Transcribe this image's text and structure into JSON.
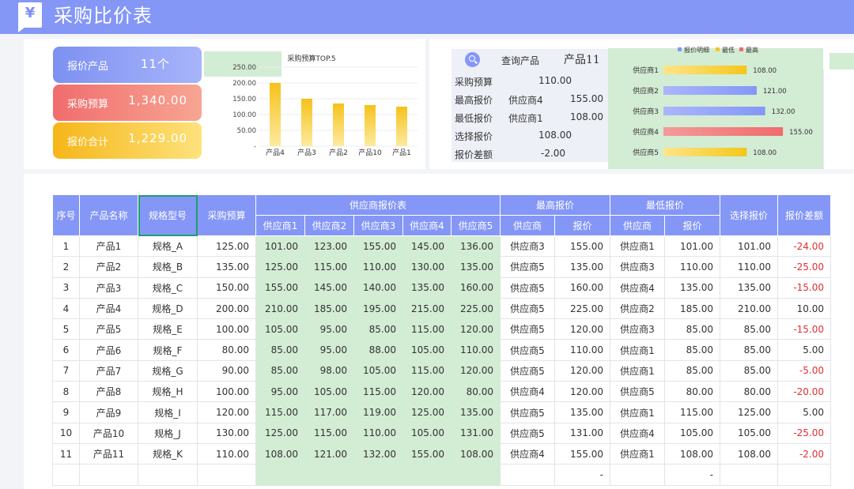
{
  "header": {
    "logo": "¥",
    "title": "采购比价表"
  },
  "kpi": [
    {
      "label": "报价产品",
      "value": "11个"
    },
    {
      "label": "采购预算",
      "value": "1,340.00"
    },
    {
      "label": "报价合计",
      "value": "1,229.00"
    }
  ],
  "top5_chart": {
    "title": "采购预算TOP.5",
    "y_ticks": [
      "250.00",
      "200.00",
      "150.00",
      "100.00",
      "50.00",
      "-"
    ]
  },
  "query": {
    "label": "查询产品",
    "product": "产品11",
    "rows": [
      {
        "label": "采购预算",
        "supplier": "",
        "value": "110.00"
      },
      {
        "label": "最高报价",
        "supplier": "供应商4",
        "value": "155.00"
      },
      {
        "label": "最低报价",
        "supplier": "供应商1",
        "value": "108.00"
      },
      {
        "label": "选择报价",
        "supplier": "",
        "value": "108.00"
      },
      {
        "label": "报价差额",
        "supplier": "",
        "value": "-2.00"
      }
    ]
  },
  "supplier_chart": {
    "legend": [
      "报价明细",
      "最低",
      "最高"
    ],
    "legend_colors": [
      "#8497f7",
      "#f5c61a",
      "#f06b6b"
    ]
  },
  "table": {
    "headers": {
      "no": "序号",
      "name": "产品名称",
      "spec": "规格型号",
      "budget": "采购预算",
      "group": "供应商报价表",
      "max": "最高报价",
      "min": "最低报价",
      "select": "选择报价",
      "diff": "报价差额",
      "supplier": "供应商",
      "price": "报价"
    },
    "supplier_cols": [
      "供应商1",
      "供应商2",
      "供应商3",
      "供应商4",
      "供应商5"
    ],
    "rows": [
      [
        "1",
        "产品1",
        "规格_A",
        "125.00",
        "101.00",
        "123.00",
        "155.00",
        "145.00",
        "136.00",
        "供应商3",
        "155.00",
        "供应商1",
        "101.00",
        "101.00",
        "-24.00"
      ],
      [
        "2",
        "产品2",
        "规格_B",
        "135.00",
        "125.00",
        "115.00",
        "110.00",
        "130.00",
        "135.00",
        "供应商5",
        "135.00",
        "供应商3",
        "110.00",
        "110.00",
        "-25.00"
      ],
      [
        "3",
        "产品3",
        "规格_C",
        "150.00",
        "155.00",
        "145.00",
        "140.00",
        "135.00",
        "160.00",
        "供应商5",
        "160.00",
        "供应商4",
        "135.00",
        "135.00",
        "-15.00"
      ],
      [
        "4",
        "产品4",
        "规格_D",
        "200.00",
        "210.00",
        "185.00",
        "195.00",
        "215.00",
        "225.00",
        "供应商5",
        "225.00",
        "供应商2",
        "185.00",
        "210.00",
        "10.00"
      ],
      [
        "5",
        "产品5",
        "规格_E",
        "100.00",
        "105.00",
        "95.00",
        "85.00",
        "115.00",
        "120.00",
        "供应商5",
        "120.00",
        "供应商3",
        "85.00",
        "85.00",
        "-15.00"
      ],
      [
        "6",
        "产品6",
        "规格_F",
        "80.00",
        "85.00",
        "95.00",
        "88.00",
        "105.00",
        "110.00",
        "供应商5",
        "110.00",
        "供应商1",
        "85.00",
        "85.00",
        "5.00"
      ],
      [
        "7",
        "产品7",
        "规格_G",
        "90.00",
        "85.00",
        "98.00",
        "105.00",
        "115.00",
        "120.00",
        "供应商5",
        "120.00",
        "供应商1",
        "85.00",
        "85.00",
        "-5.00"
      ],
      [
        "8",
        "产品8",
        "规格_H",
        "100.00",
        "95.00",
        "105.00",
        "115.00",
        "120.00",
        "80.00",
        "供应商4",
        "120.00",
        "供应商5",
        "80.00",
        "80.00",
        "-20.00"
      ],
      [
        "9",
        "产品9",
        "规格_I",
        "120.00",
        "115.00",
        "117.00",
        "119.00",
        "125.00",
        "135.00",
        "供应商5",
        "135.00",
        "供应商1",
        "115.00",
        "125.00",
        "5.00"
      ],
      [
        "10",
        "产品10",
        "规格_J",
        "130.00",
        "125.00",
        "115.00",
        "110.00",
        "105.00",
        "131.00",
        "供应商5",
        "131.00",
        "供应商4",
        "105.00",
        "105.00",
        "-25.00"
      ],
      [
        "11",
        "产品11",
        "规格_K",
        "110.00",
        "108.00",
        "121.00",
        "132.00",
        "155.00",
        "108.00",
        "供应商4",
        "155.00",
        "供应商1",
        "108.00",
        "108.00",
        "-2.00"
      ],
      [
        "",
        "",
        "",
        "",
        "",
        "",
        "",
        "",
        "",
        "",
        "-",
        "",
        "-",
        "",
        ""
      ]
    ]
  },
  "chart_data": [
    {
      "type": "bar",
      "title": "采购预算TOP.5",
      "categories": [
        "产品4",
        "产品3",
        "产品2",
        "产品10",
        "产品1"
      ],
      "values": [
        200,
        150,
        135,
        130,
        125
      ],
      "ylim": [
        0,
        250
      ],
      "ticks": [
        250,
        200,
        150,
        100,
        50,
        0
      ],
      "color": "#f5c61a"
    },
    {
      "type": "bar",
      "orientation": "horizontal",
      "categories": [
        "供应商1",
        "供应商2",
        "供应商3",
        "供应商4",
        "供应商5"
      ],
      "values": [
        108,
        121,
        132,
        155,
        108
      ],
      "labels": [
        "108.00",
        "121.00",
        "132.00",
        "155.00",
        "108.00"
      ],
      "colors": [
        "#f5c61a",
        "#8497f7",
        "#8497f7",
        "#f06b6b",
        "#f5c61a"
      ],
      "xlim": [
        0,
        160
      ]
    }
  ]
}
